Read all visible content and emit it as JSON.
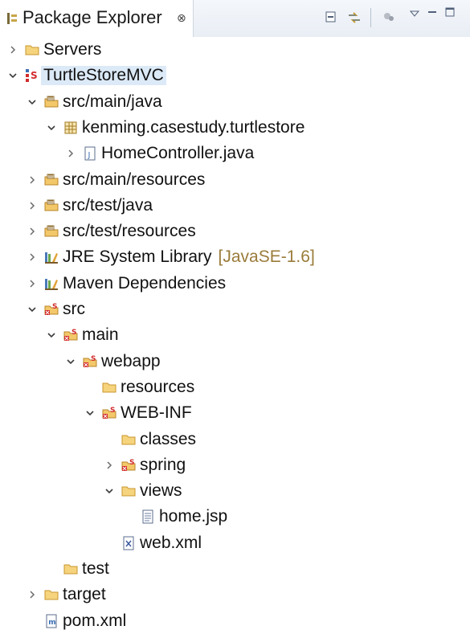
{
  "view": {
    "title": "Package Explorer",
    "close": "⊗",
    "toolbar": [
      "collapse-all",
      "link-with-editor",
      "focus-active-task",
      "view-menu",
      "minimize",
      "maximize"
    ]
  },
  "colors": {
    "folder": "#e9b949",
    "java": "#3c6fb5",
    "error": "#d22b2b",
    "decoration": "#9a7b3a"
  },
  "tree": {
    "items": [
      {
        "label": "Servers",
        "icon": "folder-icon",
        "twisty": "collapsed",
        "depth": 0
      },
      {
        "label": "TurtleStoreMVC",
        "icon": "maven-project-icon",
        "twisty": "expanded",
        "depth": 0,
        "selected": true
      },
      {
        "label": "src/main/java",
        "icon": "source-folder-icon",
        "twisty": "expanded",
        "depth": 1
      },
      {
        "label": "kenming.casestudy.turtlestore",
        "icon": "package-icon",
        "twisty": "expanded",
        "depth": 2
      },
      {
        "label": "HomeController.java",
        "icon": "java-file-icon",
        "twisty": "collapsed",
        "depth": 3
      },
      {
        "label": "src/main/resources",
        "icon": "source-folder-icon",
        "twisty": "collapsed",
        "depth": 1
      },
      {
        "label": "src/test/java",
        "icon": "source-folder-icon",
        "twisty": "collapsed",
        "depth": 1
      },
      {
        "label": "src/test/resources",
        "icon": "source-folder-icon",
        "twisty": "collapsed",
        "depth": 1
      },
      {
        "label": "JRE System Library",
        "decoration": "[JavaSE-1.6]",
        "icon": "library-icon",
        "twisty": "collapsed",
        "depth": 1
      },
      {
        "label": "Maven Dependencies",
        "icon": "library-icon",
        "twisty": "collapsed",
        "depth": 1
      },
      {
        "label": "src",
        "icon": "error-folder-icon",
        "twisty": "expanded",
        "depth": 1
      },
      {
        "label": "main",
        "icon": "error-folder-icon",
        "twisty": "expanded",
        "depth": 2
      },
      {
        "label": "webapp",
        "icon": "error-folder-icon",
        "twisty": "expanded",
        "depth": 3
      },
      {
        "label": "resources",
        "icon": "folder-icon",
        "twisty": "none",
        "depth": 4
      },
      {
        "label": "WEB-INF",
        "icon": "error-folder-icon",
        "twisty": "expanded",
        "depth": 4
      },
      {
        "label": "classes",
        "icon": "folder-icon",
        "twisty": "none",
        "depth": 5
      },
      {
        "label": "spring",
        "icon": "error-folder-icon",
        "twisty": "collapsed",
        "depth": 5
      },
      {
        "label": "views",
        "icon": "folder-icon",
        "twisty": "expanded",
        "depth": 5
      },
      {
        "label": "home.jsp",
        "icon": "jsp-file-icon",
        "twisty": "none",
        "depth": 6
      },
      {
        "label": "web.xml",
        "icon": "xml-file-icon",
        "twisty": "none",
        "depth": 5
      },
      {
        "label": "test",
        "icon": "folder-icon",
        "twisty": "none",
        "depth": 2
      },
      {
        "label": "target",
        "icon": "folder-icon",
        "twisty": "collapsed",
        "depth": 1
      },
      {
        "label": "pom.xml",
        "icon": "maven-pom-icon",
        "twisty": "none",
        "depth": 1
      }
    ]
  }
}
